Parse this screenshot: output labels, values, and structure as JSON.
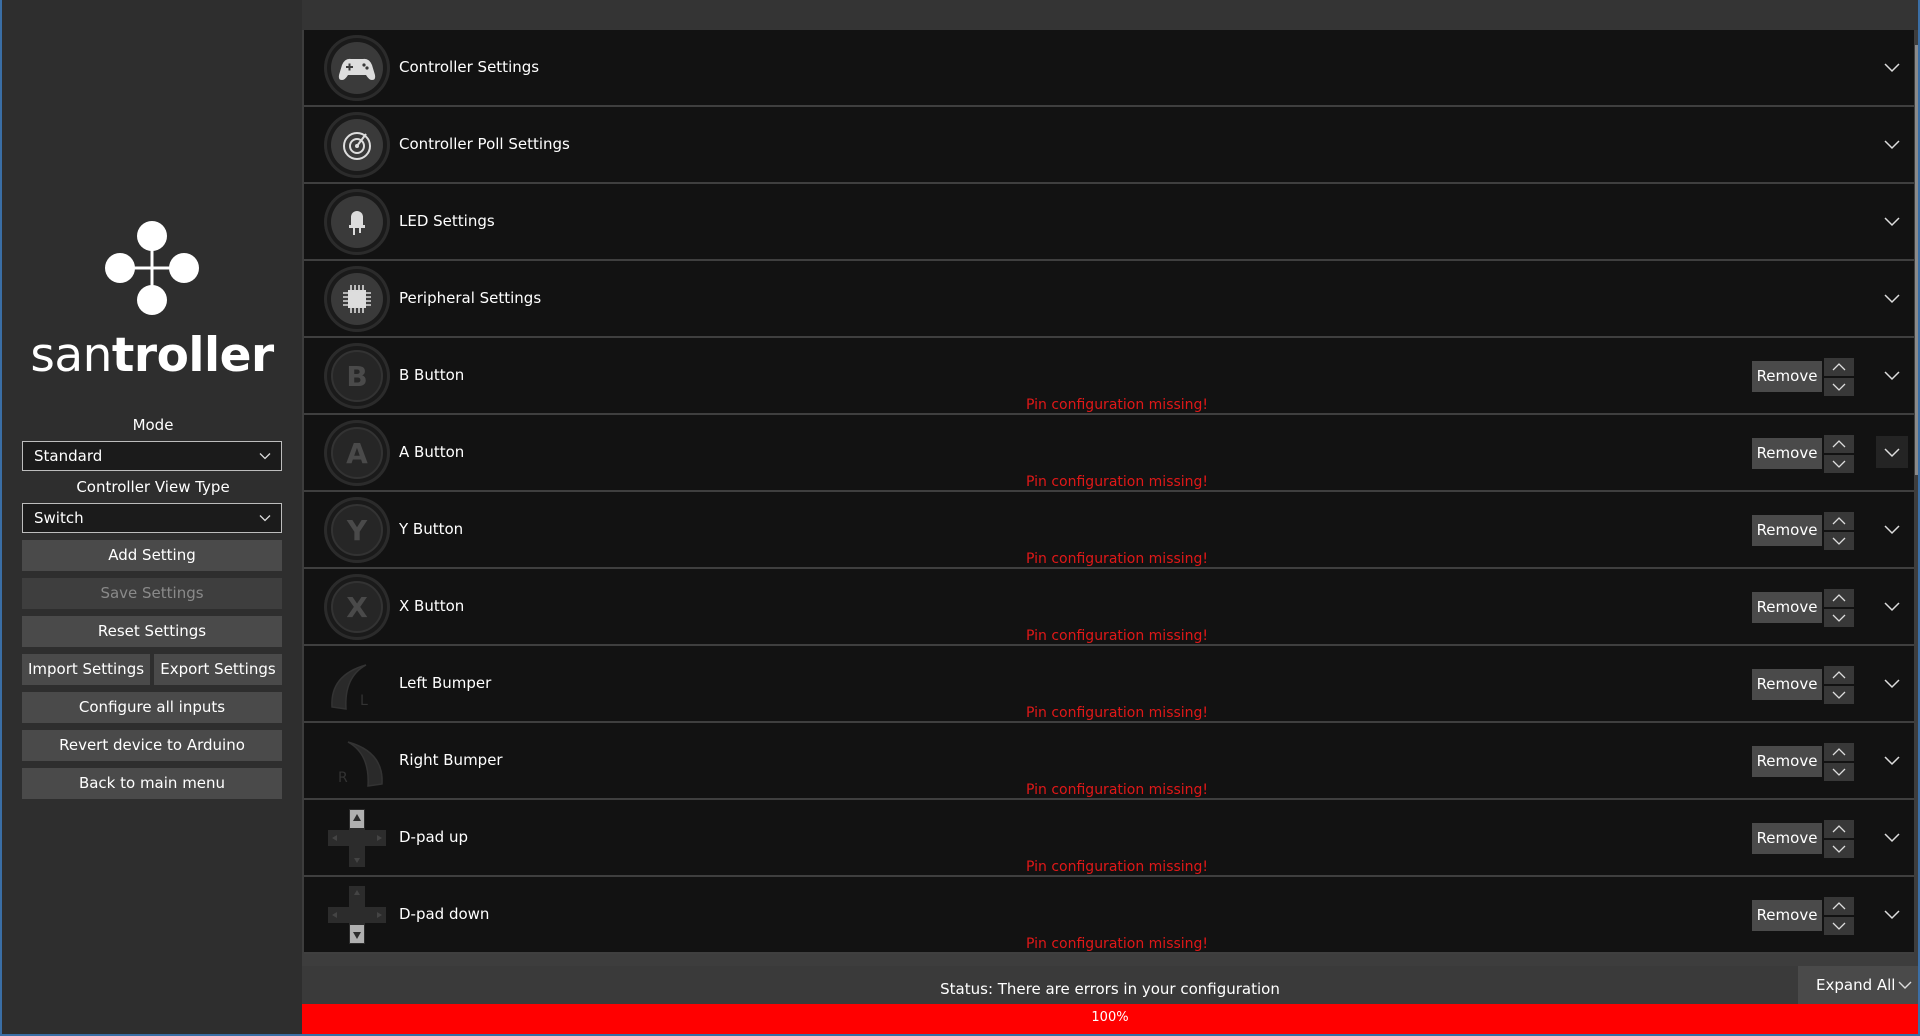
{
  "sidebar": {
    "logo_text_light": "san",
    "logo_text_bold": "troller",
    "mode_label": "Mode",
    "mode_value": "Standard",
    "view_label": "Controller View Type",
    "view_value": "Switch",
    "buttons": {
      "add": "Add Setting",
      "save": "Save Settings",
      "reset": "Reset Settings",
      "import": "Import Settings",
      "export": "Export Settings",
      "configure": "Configure all inputs",
      "revert": "Revert device to Arduino",
      "back": "Back to main menu"
    }
  },
  "rows": [
    {
      "title": "Controller Settings",
      "icon": "gamepad-icon"
    },
    {
      "title": "Controller Poll Settings",
      "icon": "poll-icon"
    },
    {
      "title": "LED Settings",
      "icon": "led-icon"
    },
    {
      "title": "Peripheral Settings",
      "icon": "chip-icon"
    },
    {
      "title": "B Button",
      "icon": "b-button-icon",
      "error": "Pin configuration missing!",
      "remove": "Remove"
    },
    {
      "title": "A Button",
      "icon": "a-button-icon",
      "error": "Pin configuration missing!",
      "remove": "Remove"
    },
    {
      "title": "Y Button",
      "icon": "y-button-icon",
      "error": "Pin configuration missing!",
      "remove": "Remove"
    },
    {
      "title": "X Button",
      "icon": "x-button-icon",
      "error": "Pin configuration missing!",
      "remove": "Remove"
    },
    {
      "title": "Left Bumper",
      "icon": "left-bumper-icon",
      "error": "Pin configuration missing!",
      "remove": "Remove"
    },
    {
      "title": "Right Bumper",
      "icon": "right-bumper-icon",
      "error": "Pin configuration missing!",
      "remove": "Remove"
    },
    {
      "title": "D-pad up",
      "icon": "dpad-up-icon",
      "error": "Pin configuration missing!",
      "remove": "Remove"
    },
    {
      "title": "D-pad down",
      "icon": "dpad-down-icon",
      "error": "Pin configuration missing!",
      "remove": "Remove"
    }
  ],
  "status": {
    "text": "Status: There are errors in your configuration",
    "expand_all": "Expand All",
    "progress": "100%",
    "progress_color": "#ff0000",
    "error_color": "#e01818"
  }
}
